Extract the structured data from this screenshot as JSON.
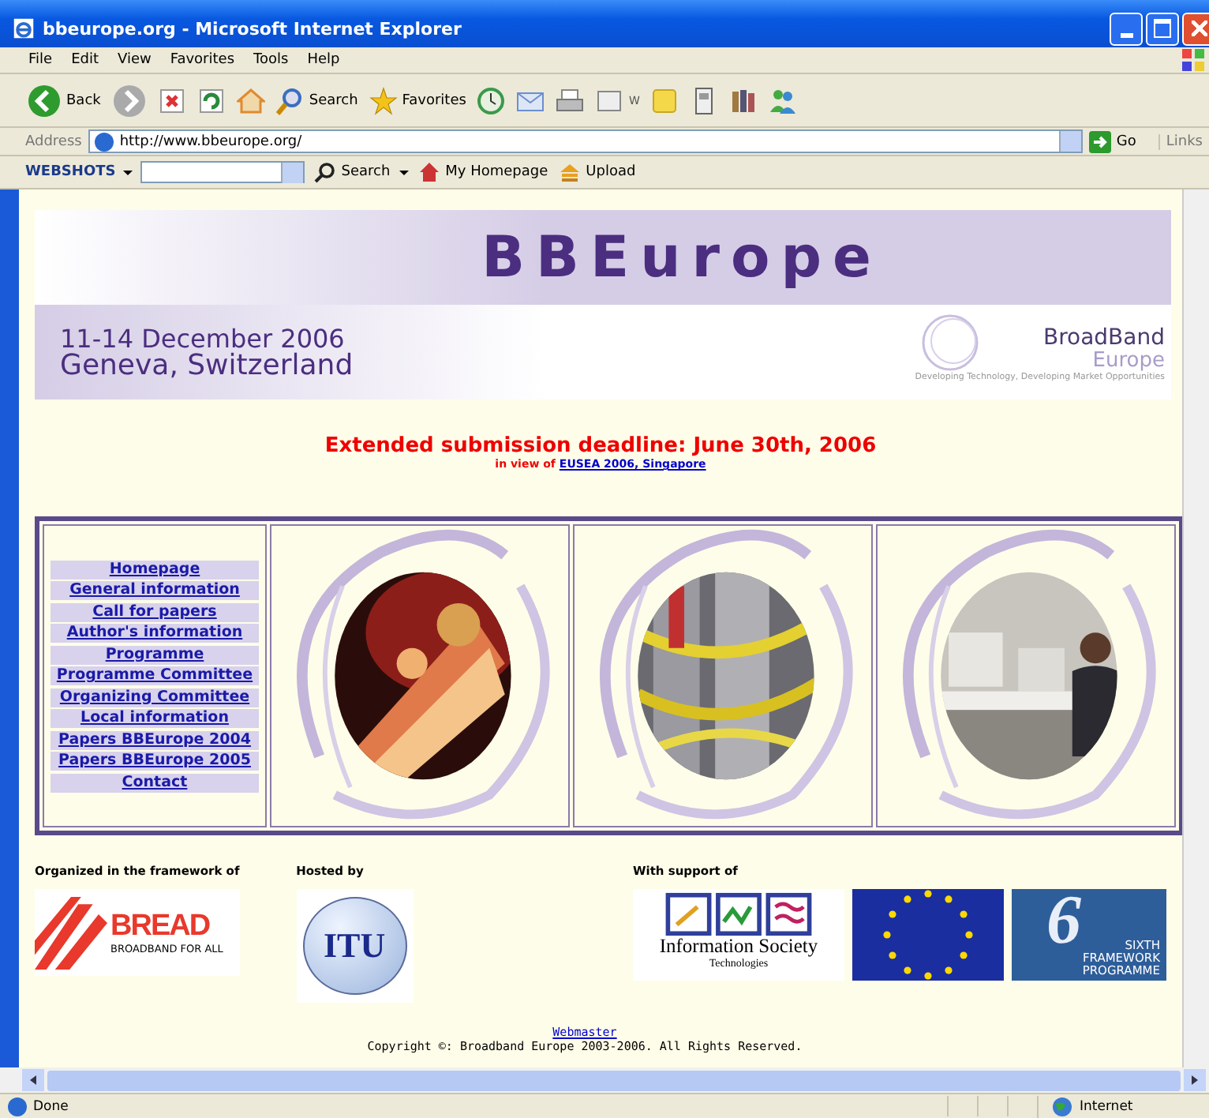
{
  "window": {
    "title": "bbeurope.org - Microsoft Internet Explorer"
  },
  "menu": [
    "File",
    "Edit",
    "View",
    "Favorites",
    "Tools",
    "Help"
  ],
  "toolbar": [
    {
      "kind": "back",
      "label": "Back"
    },
    {
      "kind": "forward"
    },
    {
      "kind": "stop"
    },
    {
      "kind": "refresh"
    },
    {
      "kind": "home"
    },
    {
      "kind": "search",
      "label": "Search"
    },
    {
      "kind": "favorites",
      "label": "Favorites"
    },
    {
      "kind": "history"
    },
    {
      "kind": "mail"
    },
    {
      "kind": "print"
    },
    {
      "kind": "edit",
      "label": "W"
    },
    {
      "kind": "note"
    },
    {
      "kind": "calc"
    },
    {
      "kind": "research"
    },
    {
      "kind": "people"
    }
  ],
  "address": {
    "label": "Address",
    "value": "http://www.bbeurope.org/",
    "go": "Go",
    "links": "Links"
  },
  "webshots": {
    "brand": "WEBSHOTS",
    "search": "Search",
    "homepage": "My Homepage",
    "upload": "Upload"
  },
  "banner": {
    "title": "BBEurope",
    "dates": "11-14 December 2006",
    "place": "Geneva, Switzerland",
    "logo_line1": "BroadBand",
    "logo_line2": "Europe",
    "tagline": "Developing Technology, Developing Market Opportunities"
  },
  "deadline": {
    "title": "Extended submission deadline: June 30th, 2006",
    "prefix": "in view of",
    "link": "EUSEA 2006, Singapore"
  },
  "nav": [
    "Homepage",
    "General information",
    "Call for papers",
    "Author's information",
    "Programme",
    "Programme Committee",
    "Organizing Committee",
    "Local information",
    "Papers BBEurope 2004",
    "Papers BBEurope 2005",
    "Contact"
  ],
  "sponsors": [
    {
      "heading": "Organized in the framework of",
      "logos": [
        {
          "kind": "bread",
          "text": "BREAD",
          "sub": "BROADBAND FOR ALL"
        }
      ]
    },
    {
      "heading": "Hosted by",
      "logos": [
        {
          "kind": "itu",
          "text": "ITU"
        }
      ]
    },
    {
      "heading": "With support of",
      "logos": [
        {
          "kind": "ist",
          "text": "Information Society",
          "sub": "Technologies"
        },
        {
          "kind": "eu"
        },
        {
          "kind": "fp6",
          "number": "6",
          "text": "SIXTH",
          "sub": "FRAMEWORK PROGRAMME"
        }
      ]
    }
  ],
  "footer": {
    "link": "Webmaster",
    "copyright": "Copyright ©: Broadband Europe 2003-2006. All Rights Reserved."
  },
  "status_bar": {
    "text": "Done",
    "zone": "Internet"
  }
}
